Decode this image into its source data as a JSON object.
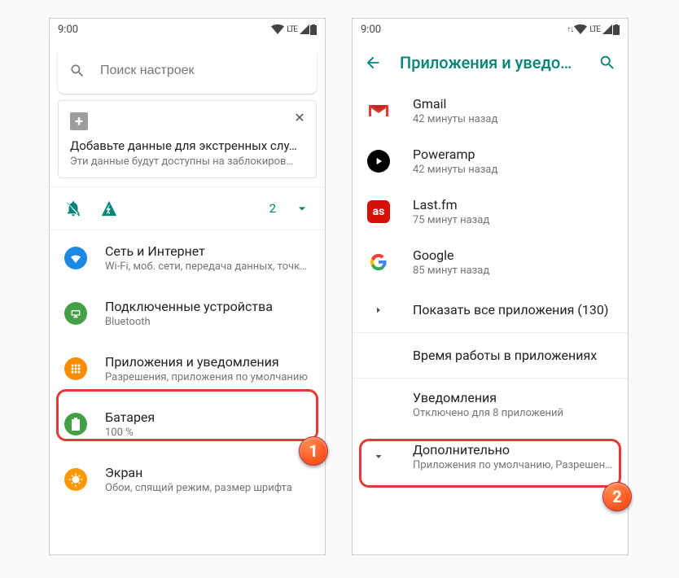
{
  "left": {
    "status": {
      "clock": "9:00",
      "lte": "LTE"
    },
    "search": {
      "placeholder": "Поиск настроек"
    },
    "emergency": {
      "title": "Добавьте данные для экстренных слу…",
      "sub": "Эти данные будут доступны на заблокиров…"
    },
    "quick": {
      "count": "2"
    },
    "rows": [
      {
        "title": "Сеть и Интернет",
        "sub": "Wi-Fi, моб. сети, передача данных, точк…"
      },
      {
        "title": "Подключенные устройства",
        "sub": "Bluetooth"
      },
      {
        "title": "Приложения и уведомления",
        "sub": "Разрешения, приложения по умолчанию"
      },
      {
        "title": "Батарея",
        "sub": "100 %"
      },
      {
        "title": "Экран",
        "sub": "Обои, спящий режим, размер шрифта"
      }
    ]
  },
  "right": {
    "status": {
      "clock": "9:00",
      "lte": "LTE"
    },
    "appbar": {
      "title": "Приложения и уведом…"
    },
    "apps": [
      {
        "title": "Gmail",
        "sub": "42 минуты назад"
      },
      {
        "title": "Poweramp",
        "sub": "42 минуты назад"
      },
      {
        "title": "Last.fm",
        "sub": "75 минут назад"
      },
      {
        "title": "Google",
        "sub": "85 минут назад"
      }
    ],
    "showall": "Показать все приложения (130)",
    "screentime": "Время работы в приложениях",
    "notif": {
      "title": "Уведомления",
      "sub": "Отключено для 8 приложений"
    },
    "more": {
      "title": "Дополнительно",
      "sub": "Приложения по умолчанию, Разрешени…"
    }
  },
  "callouts": {
    "one": "1",
    "two": "2"
  }
}
